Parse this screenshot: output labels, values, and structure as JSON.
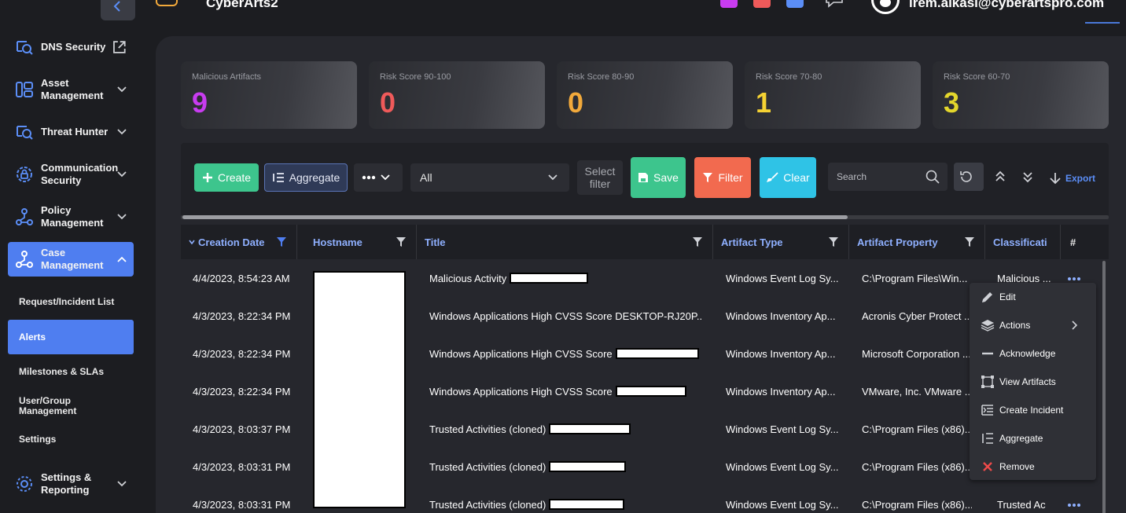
{
  "topbar": {
    "app_name": "CyberArts2",
    "user_email": "irem.alkasi@cyberartspro.com",
    "swatches": [
      "#c83cf0",
      "#ef5a5a",
      "#5b8ef7"
    ]
  },
  "sidebar": {
    "items": [
      {
        "label": "DNS Security",
        "icon": "dns-security-icon"
      },
      {
        "label": "Asset Management",
        "icon": "asset-management-icon"
      },
      {
        "label": "Threat Hunter",
        "icon": "threat-hunter-icon"
      },
      {
        "label": "Communication Security",
        "icon": "communication-security-icon"
      },
      {
        "label": "Policy Management",
        "icon": "policy-management-icon"
      },
      {
        "label": "Case Management",
        "icon": "case-management-icon"
      },
      {
        "label": "Settings & Reporting",
        "icon": "settings-icon"
      }
    ],
    "submenu": [
      "Request/Incident List",
      "Alerts",
      "Milestones & SLAs",
      "User/Group Management",
      "Settings"
    ]
  },
  "stats": [
    {
      "label": "Malicious Artifacts",
      "value": "9",
      "color": "#c83cf0"
    },
    {
      "label": "Risk Score 90-100",
      "value": "0",
      "color": "#ef5a5a"
    },
    {
      "label": "Risk Score 80-90",
      "value": "0",
      "color": "#f2a93b"
    },
    {
      "label": "Risk Score 70-80",
      "value": "1",
      "color": "#f5d233"
    },
    {
      "label": "Risk Score 60-70",
      "value": "3",
      "color": "#e3d62c"
    }
  ],
  "toolbar": {
    "create_label": "Create",
    "aggregate_label": "Aggregate",
    "select_value": "All",
    "select_filter_label": "Select filter",
    "save_label": "Save",
    "filter_label": "Filter",
    "clear_label": "Clear",
    "search_placeholder": "Search",
    "export_label": "Export"
  },
  "table": {
    "columns": [
      "Creation Date",
      "Hostname",
      "Title",
      "Artifact Type",
      "Artifact Property",
      "Classificati",
      "#"
    ],
    "rows": [
      {
        "date": "4/4/2023, 8:54:23 AM",
        "title": "Malicious Activity",
        "type": "Windows Event Log Sy...",
        "property": "C:\\Program Files\\Win...",
        "classification": "Malicious ..."
      },
      {
        "date": "4/3/2023, 8:22:34 PM",
        "title": "Windows Applications High CVSS Score DESKTOP-RJ20P...",
        "type": "Windows Inventory Ap...",
        "property": "Acronis Cyber Protect ...",
        "classification": ""
      },
      {
        "date": "4/3/2023, 8:22:34 PM",
        "title": "Windows Applications High CVSS Score",
        "type": "Windows Inventory Ap...",
        "property": "Microsoft Corporation ...",
        "classification": ""
      },
      {
        "date": "4/3/2023, 8:22:34 PM",
        "title": "Windows Applications High CVSS Score",
        "type": "Windows Inventory Ap...",
        "property": "VMware, Inc. VMware ...",
        "classification": ""
      },
      {
        "date": "4/3/2023, 8:03:37 PM",
        "title": "Trusted Activities (cloned)",
        "type": "Windows Event Log Sy...",
        "property": "C:\\Program Files (x86)...",
        "classification": ""
      },
      {
        "date": "4/3/2023, 8:03:31 PM",
        "title": "Trusted Activities (cloned)",
        "type": "Windows Event Log Sy...",
        "property": "C:\\Program Files (x86)...",
        "classification": ""
      },
      {
        "date": "4/3/2023, 8:03:31 PM",
        "title": "Trusted Activities (cloned)",
        "type": "Windows Event Log Sy...",
        "property": "C:\\Program Files (x86)...",
        "classification": "Trusted Ac"
      }
    ]
  },
  "context_menu": [
    "Edit",
    "Actions",
    "Acknowledge",
    "View Artifacts",
    "Create Incident",
    "Aggregate",
    "Remove"
  ]
}
